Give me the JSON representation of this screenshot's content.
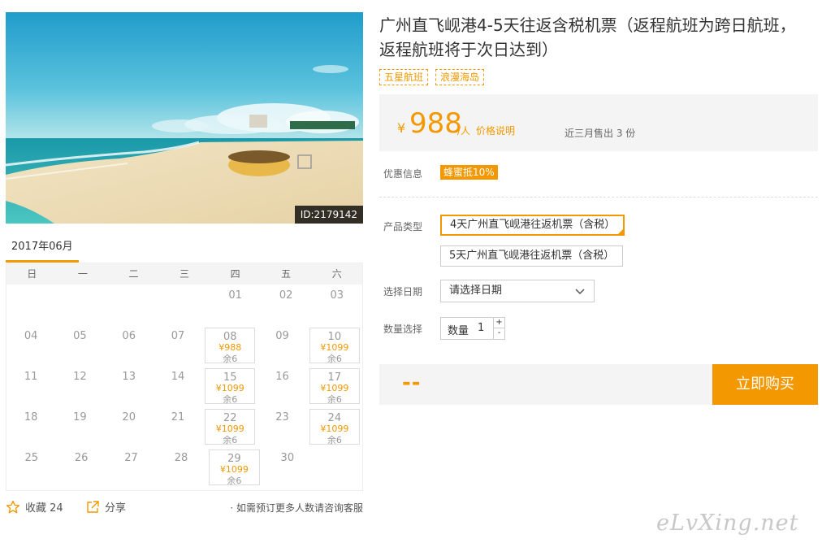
{
  "product": {
    "photo_id": "ID:2179142",
    "title": "广州直飞岘港4-5天往返含税机票（返程航班为跨日航班，返程航班将于次日达到）",
    "tags": [
      "五星航班",
      "浪漫海岛"
    ]
  },
  "price": {
    "currency": "¥",
    "amount": "988",
    "unit": "/人",
    "note": "价格说明",
    "sold": "近三月售出 3 份"
  },
  "promo": {
    "label": "优惠信息",
    "badge": "蜂蜜抵10%"
  },
  "product_type": {
    "label": "产品类型",
    "options": [
      "4天广州直飞岘港往返机票（含税）",
      "5天广州直飞岘港往返机票（含税）"
    ],
    "selected_index": 0
  },
  "date_select": {
    "label": "选择日期",
    "value": "请选择日期"
  },
  "quantity": {
    "label": "数量选择",
    "inner_label": "数量",
    "value": "1",
    "plus": "+",
    "minus": "-"
  },
  "buy": {
    "total": "--",
    "button": "立即购买"
  },
  "calendar": {
    "month": "2017年06月",
    "weekdays": [
      "日",
      "一",
      "二",
      "三",
      "四",
      "五",
      "六"
    ],
    "weeks": [
      [
        null,
        null,
        null,
        null,
        {
          "d": "01"
        },
        {
          "d": "02"
        },
        {
          "d": "03"
        }
      ],
      [
        {
          "d": "04"
        },
        {
          "d": "05"
        },
        {
          "d": "06"
        },
        {
          "d": "07"
        },
        {
          "d": "08",
          "p": "¥988",
          "s": "余6"
        },
        {
          "d": "09"
        },
        {
          "d": "10",
          "p": "¥1099",
          "s": "余6"
        }
      ],
      [
        {
          "d": "11"
        },
        {
          "d": "12"
        },
        {
          "d": "13"
        },
        {
          "d": "14"
        },
        {
          "d": "15",
          "p": "¥1099",
          "s": "余6"
        },
        {
          "d": "16"
        },
        {
          "d": "17",
          "p": "¥1099",
          "s": "余6"
        }
      ],
      [
        {
          "d": "18"
        },
        {
          "d": "19"
        },
        {
          "d": "20"
        },
        {
          "d": "21"
        },
        {
          "d": "22",
          "p": "¥1099",
          "s": "余6"
        },
        {
          "d": "23"
        },
        {
          "d": "24",
          "p": "¥1099",
          "s": "余6"
        }
      ],
      [
        {
          "d": "25"
        },
        {
          "d": "26"
        },
        {
          "d": "27"
        },
        {
          "d": "28"
        },
        {
          "d": "29",
          "p": "¥1099",
          "s": "余6"
        },
        {
          "d": "30"
        },
        null
      ]
    ]
  },
  "footer": {
    "favorite": "收藏 24",
    "share": "分享",
    "contact": "· 如需预订更多人数请咨询客服"
  },
  "watermark": "eLvXing.net",
  "colors": {
    "accent": "#f39800",
    "panel": "#f4f4f4"
  },
  "icons": [
    "star-icon",
    "share-icon",
    "chevron-down-icon"
  ]
}
